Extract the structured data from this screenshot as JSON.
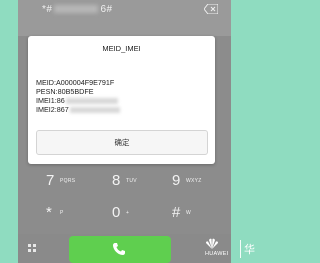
{
  "dialer": {
    "number_prefix": "*#",
    "number_suffix": "6#"
  },
  "dialog": {
    "title": "MEID_IMEI",
    "meid": "MEID:A000004F9E791F",
    "pesn": "PESN:80B5BDFE",
    "imei1_prefix": "IMEI1:86",
    "imei2_prefix": "IMEI2:867",
    "ok_label": "确定"
  },
  "keypad": [
    {
      "digit": "7",
      "letters": "PQRS"
    },
    {
      "digit": "8",
      "letters": "TUV"
    },
    {
      "digit": "9",
      "letters": "WXYZ"
    },
    {
      "digit": "*",
      "letters": "P"
    },
    {
      "digit": "0",
      "letters": "+"
    },
    {
      "digit": "#",
      "letters": "W"
    }
  ],
  "brand": {
    "name": "HUAWEI",
    "char": "华"
  },
  "colors": {
    "background": "#8fdcc0",
    "call_button": "#5fcf4f",
    "brand_red": "#e33b2e"
  }
}
